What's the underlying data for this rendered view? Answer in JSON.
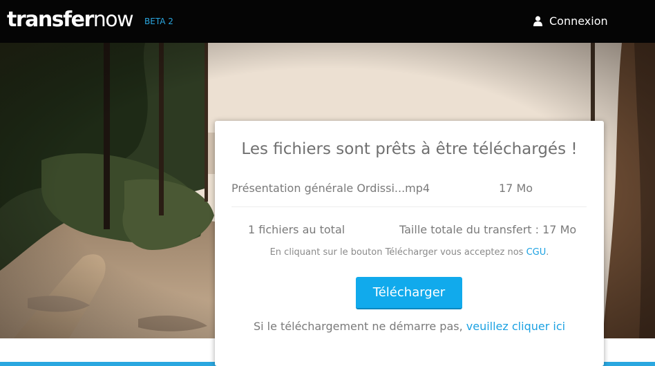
{
  "header": {
    "logo_bold": "transfer",
    "logo_light": "now",
    "beta_label": "BETA 2",
    "login_label": "Connexion",
    "login_icon": "user-icon"
  },
  "card": {
    "title": "Les fichiers sont prêts à être téléchargés !",
    "files": [
      {
        "name": "Présentation générale Ordissi...mp4",
        "size": "17 Mo"
      }
    ],
    "total_count": "1 fichiers au total",
    "total_size": "Taille totale du transfert : 17 Mo",
    "terms_prefix": "En cliquant sur le bouton Télécharger vous acceptez nos",
    "terms_link": "CGU",
    "terms_suffix": ".",
    "download_label": "Télécharger",
    "retry_prefix": "Si le téléchargement ne démarre pas,",
    "retry_link": "veuillez cliquer ici"
  },
  "colors": {
    "accent": "#11aaec",
    "link": "#1ba1e2",
    "topbar": "#050505"
  }
}
